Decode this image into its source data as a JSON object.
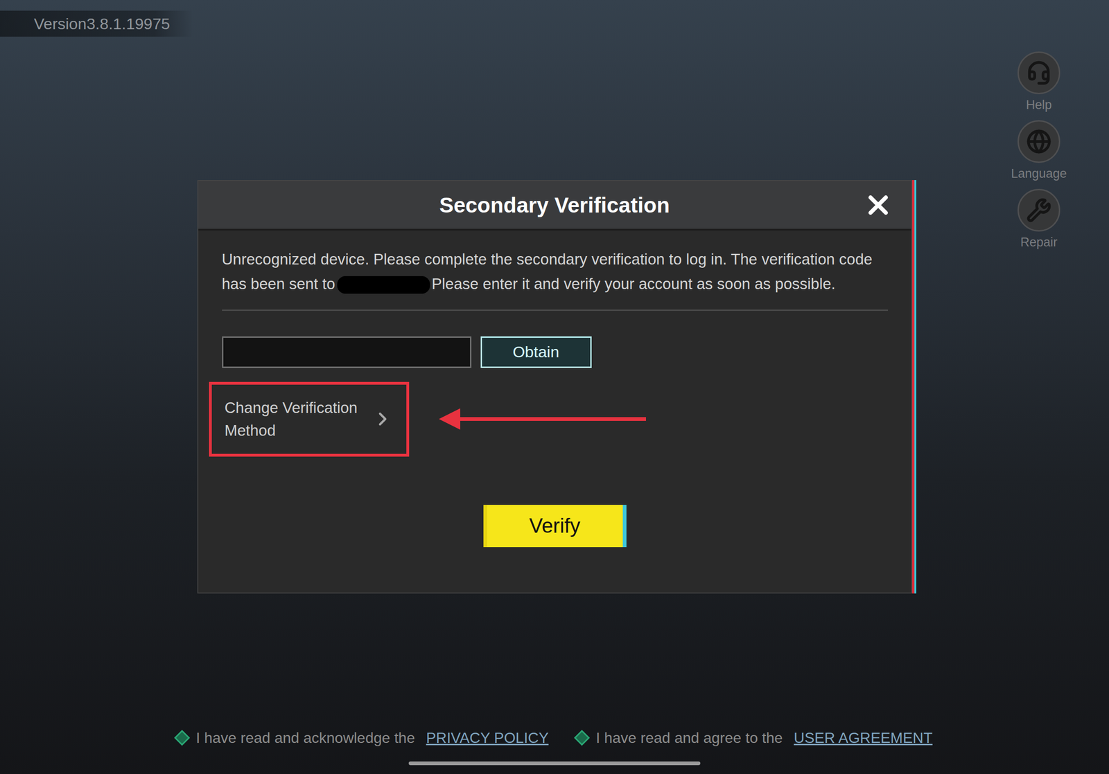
{
  "version": "Version3.8.1.19975",
  "side_menu": [
    {
      "label": "Help"
    },
    {
      "label": "Language"
    },
    {
      "label": "Repair"
    }
  ],
  "dialog": {
    "title": "Secondary Verification",
    "message_before": "Unrecognized device. Please complete the secondary verification to log in. The verification code has been sent to",
    "recipient": {
      "redacted": true
    },
    "message_after": "Please enter it and verify your account as soon as possible.",
    "code_input": {
      "value": ""
    },
    "obtain_button": "Obtain",
    "change_method": {
      "label": "Change Verification Method",
      "highlighted": true
    },
    "verify_button": "Verify"
  },
  "agreements": [
    {
      "text": "I have read and acknowledge the",
      "link": "PRIVACY POLICY",
      "checked": true
    },
    {
      "text": "I have read and agree to the",
      "link": "USER AGREEMENT",
      "checked": true
    }
  ]
}
